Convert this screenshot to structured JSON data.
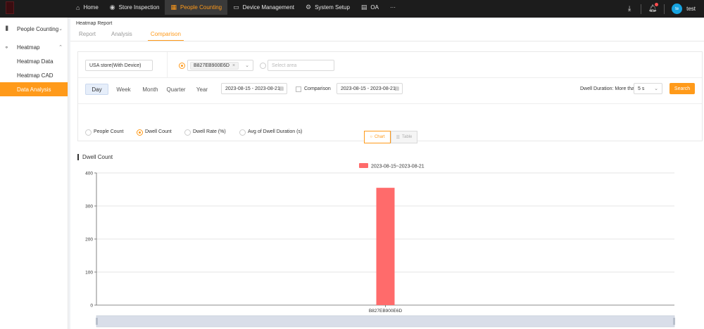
{
  "topnav": {
    "items": [
      {
        "label": "Home",
        "icon": "home-icon",
        "glyph": "⌂",
        "active": false
      },
      {
        "label": "Store Inspection",
        "icon": "camera-icon",
        "glyph": "◉",
        "active": false
      },
      {
        "label": "People Counting",
        "icon": "grid-icon",
        "glyph": "▦",
        "active": true
      },
      {
        "label": "Device Management",
        "icon": "monitor-icon",
        "glyph": "▭",
        "active": false
      },
      {
        "label": "System Setup",
        "icon": "gear-icon",
        "glyph": "⚙",
        "active": false
      },
      {
        "label": "OA",
        "icon": "calendar-icon",
        "glyph": "▤",
        "active": false
      },
      {
        "label": "···",
        "icon": "more-icon",
        "glyph": "",
        "active": false
      }
    ],
    "user": {
      "initials": "te",
      "name": "test"
    }
  },
  "sidebar": {
    "groups": [
      {
        "label": "People Counting",
        "icon": "bar-chart-icon",
        "glyph": "▐▌",
        "expanded": false
      },
      {
        "label": "Heatmap",
        "icon": "heatmap-icon",
        "glyph": "⚬",
        "expanded": true
      }
    ],
    "subitems": [
      {
        "label": "Heatmap Data",
        "active": false
      },
      {
        "label": "Heatmap CAD",
        "active": false
      },
      {
        "label": "Data Analysis",
        "active": true
      }
    ]
  },
  "page": {
    "breadcrumb": "Heatmap Report",
    "tabs": [
      {
        "label": "Report",
        "active": false
      },
      {
        "label": "Analysis",
        "active": false
      },
      {
        "label": "Comparison",
        "active": true
      }
    ]
  },
  "filters": {
    "store": "USA store(With Device)",
    "device_tag": "B827EB900E6D",
    "area_placeholder": "Select area",
    "periods": [
      "Day",
      "Week",
      "Month",
      "Quarter",
      "Year"
    ],
    "active_period": "Day",
    "date_range": "2023-08-15 - 2023-08-21",
    "comparison_label": "Comparison",
    "comparison_range": "2023-08-15 - 2023-08-21",
    "dwell_label": "Dwell Duration: More than",
    "dwell_value": "5 s",
    "search_label": "Search",
    "metrics": [
      {
        "label": "People Count",
        "selected": false
      },
      {
        "label": "Dwell Count",
        "selected": true
      },
      {
        "label": "Dwell Rate (%)",
        "selected": false
      },
      {
        "label": "Avg of Dwell Duration (s)",
        "selected": false
      }
    ]
  },
  "view_toggle": {
    "chart": "Chart",
    "table": "Table",
    "active": "chart"
  },
  "section_title": "Dwell Count",
  "chart_data": {
    "type": "bar",
    "categories": [
      "B827EB900E6D"
    ],
    "series": [
      {
        "name": "2023-08-15~2023-08-21",
        "values": [
          355
        ],
        "color": "#ff6b6b"
      }
    ],
    "ylim": [
      0,
      400
    ],
    "yticks": [
      0,
      100,
      200,
      300,
      400
    ],
    "grid": true,
    "legend": "top-center"
  }
}
